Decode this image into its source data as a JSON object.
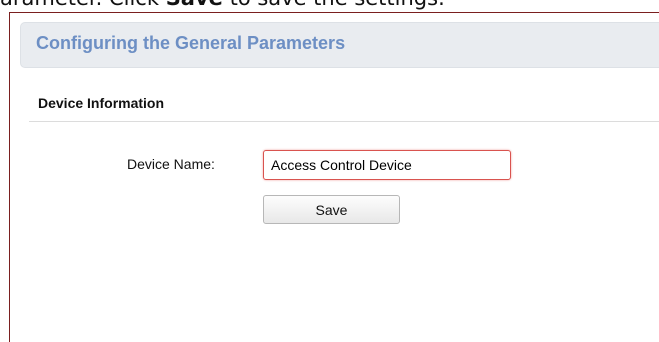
{
  "document": {
    "instruction_prefix": "arameter. Click ",
    "instruction_bold": "Save",
    "instruction_suffix": " to save the settings."
  },
  "header": {
    "title": "Configuring the General Parameters"
  },
  "section": {
    "title": "Device Information"
  },
  "form": {
    "device_name_label": "Device Name:",
    "device_name_value": "Access Control Device",
    "save_label": "Save"
  },
  "colors": {
    "title_text": "#6d8fc4",
    "header_background": "#e9ecf0",
    "input_border_focus": "#d9534f",
    "frame_border": "#7a1f1f"
  }
}
